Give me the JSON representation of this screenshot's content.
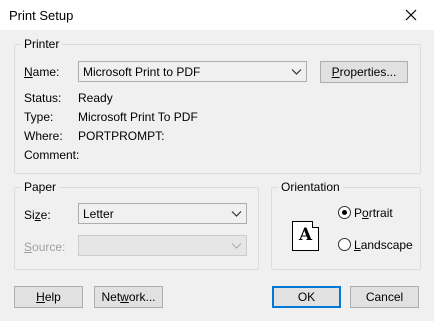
{
  "window": {
    "title": "Print Setup"
  },
  "printer": {
    "group_label": "Printer",
    "name_label_pre": "",
    "name_label_u": "N",
    "name_label_post": "ame:",
    "name_value": "Microsoft Print to PDF",
    "properties_pre": "",
    "properties_u": "P",
    "properties_post": "roperties...",
    "status_label": "Status:",
    "status_value": "Ready",
    "type_label": "Type:",
    "type_value": "Microsoft Print To PDF",
    "where_label": "Where:",
    "where_value": "PORTPROMPT:",
    "comment_label": "Comment:"
  },
  "paper": {
    "group_label": "Paper",
    "size_label_pre": "Si",
    "size_label_u": "z",
    "size_label_post": "e:",
    "size_value": "Letter",
    "source_label_u": "S",
    "source_label_post": "ource:",
    "source_value": ""
  },
  "orientation": {
    "group_label": "Orientation",
    "paper_letter": "A",
    "portrait_pre": "P",
    "portrait_u": "o",
    "portrait_post": "rtrait",
    "portrait_selected": true,
    "landscape_u": "L",
    "landscape_post": "andscape",
    "landscape_selected": false
  },
  "buttons": {
    "help_u": "H",
    "help_post": "elp",
    "network_pre": "Net",
    "network_u": "w",
    "network_post": "ork...",
    "ok": "OK",
    "cancel": "Cancel"
  },
  "colors": {
    "focus_border": "#0078d7",
    "dialog_bg": "#f0f0f0"
  },
  "icons": {
    "close": "close-icon",
    "dropdown": "chevron-down-icon"
  }
}
